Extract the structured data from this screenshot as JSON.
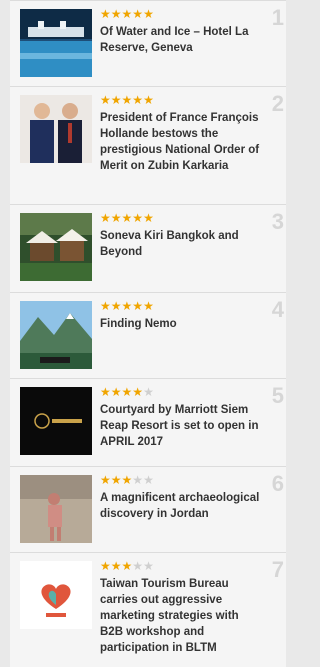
{
  "items": [
    {
      "rank": "1",
      "rating": 5,
      "title": "Of Water and Ice – Hotel La Reserve, Geneva",
      "thumb": "pool-icon"
    },
    {
      "rank": "2",
      "rating": 5,
      "title": "President of France François Hollande bestows the prestigious National Order of Merit on Zubin Karkaria",
      "thumb": "people-icon"
    },
    {
      "rank": "3",
      "rating": 5,
      "title": "Soneva Kiri Bangkok and Beyond",
      "thumb": "cabana-icon"
    },
    {
      "rank": "4",
      "rating": 5,
      "title": "Finding Nemo",
      "thumb": "mountain-icon"
    },
    {
      "rank": "5",
      "rating": 4,
      "title": "Courtyard by Marriott Siem Reap Resort is set to open in APRIL 2017",
      "thumb": "logo-dark-icon"
    },
    {
      "rank": "6",
      "rating": 3,
      "title": "A magnificent archaeological discovery in Jordan",
      "thumb": "ruins-icon"
    },
    {
      "rank": "7",
      "rating": 3,
      "title": "Taiwan Tourism Bureau carries out aggressive marketing strategies with B2B workshop and participation in BLTM",
      "thumb": "heart-logo-icon"
    }
  ],
  "colors": {
    "star_on": "#f0a500",
    "star_off": "#cfcfcf"
  }
}
